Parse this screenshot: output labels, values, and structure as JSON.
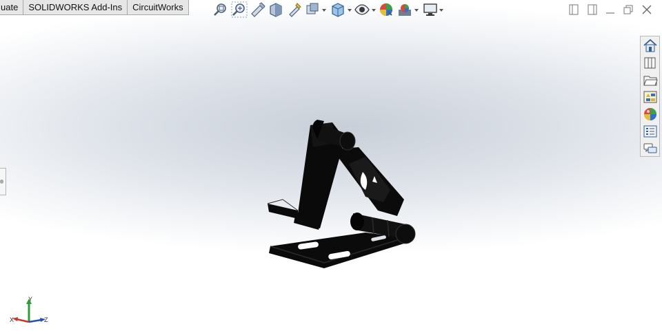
{
  "command_tabs": [
    "uate",
    "SOLIDWORKS Add-Ins",
    "CircuitWorks"
  ],
  "heads_up_toolbar": [
    {
      "icon": "zoom-to-fit-icon"
    },
    {
      "icon": "zoom-to-area-icon"
    },
    {
      "icon": "previous-view-icon"
    },
    {
      "icon": "section-view-icon"
    },
    {
      "icon": "dynamic-annotation-views-icon"
    },
    {
      "icon": "view-orientation-icon"
    },
    {
      "icon": "display-style-icon"
    },
    {
      "icon": "hide-show-items-icon"
    },
    {
      "icon": "edit-appearance-icon"
    },
    {
      "icon": "apply-scene-icon"
    },
    {
      "icon": "view-settings-icon"
    }
  ],
  "window_controls": [
    "split-left-icon",
    "split-right-icon",
    "minimize-icon",
    "restore-icon",
    "close-icon"
  ],
  "task_pane": [
    "solidworks-resources-icon",
    "design-library-icon",
    "file-explorer-icon",
    "view-palette-icon",
    "appearances-scenes-icon",
    "custom-properties-icon",
    "forum-icon"
  ],
  "triad": {
    "x": "X",
    "y": "Y",
    "z": "Z"
  },
  "colors": {
    "model": "#0b0b0b",
    "x_axis": "#c0392b",
    "y_axis": "#2e9b3a",
    "z_axis": "#1f4fb8"
  }
}
